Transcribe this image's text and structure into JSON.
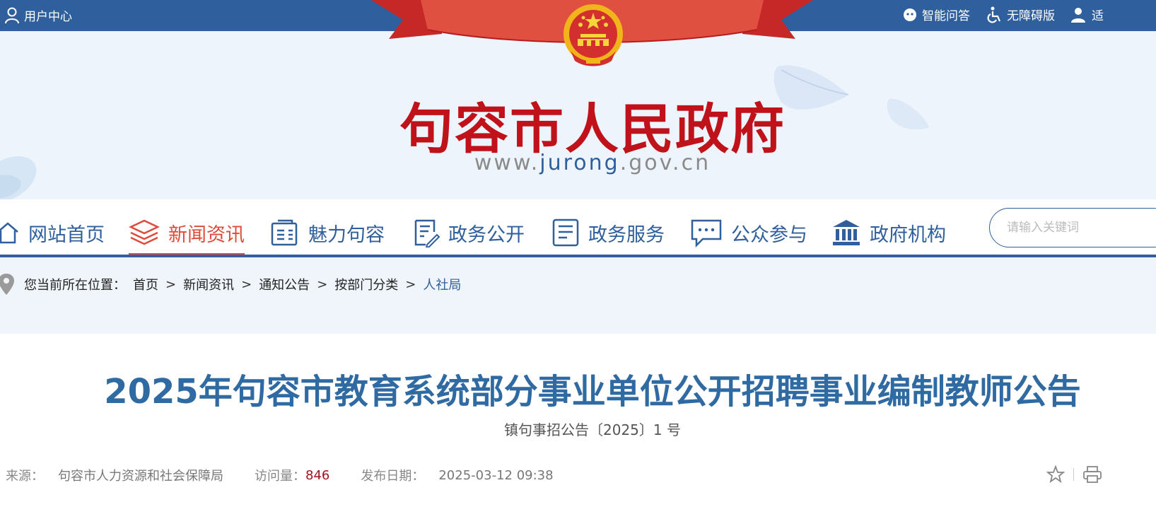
{
  "topbar": {
    "user_center": "用户中心",
    "smart_qa": "智能问答",
    "accessibility": "无障碍版",
    "elder_mode": "适"
  },
  "header": {
    "title": "句容市人民政府",
    "url_prefix": "www.",
    "url_highlight": "jurong",
    "url_suffix": ".gov.cn"
  },
  "nav": {
    "items": [
      {
        "label": "网站首页",
        "icon": "home-icon"
      },
      {
        "label": "新闻资讯",
        "icon": "layers-icon",
        "active": true
      },
      {
        "label": "魅力句容",
        "icon": "document-icon"
      },
      {
        "label": "政务公开",
        "icon": "edit-document-icon"
      },
      {
        "label": "政务服务",
        "icon": "list-icon"
      },
      {
        "label": "公众参与",
        "icon": "chat-icon"
      },
      {
        "label": "政府机构",
        "icon": "institution-icon"
      }
    ],
    "search_placeholder": "请输入关键词"
  },
  "breadcrumb": {
    "label": "您当前所在位置：",
    "items": [
      "首页",
      "新闻资讯",
      "通知公告",
      "按部门分类"
    ],
    "current": "人社局",
    "separator": ">"
  },
  "article": {
    "title": "2025年句容市教育系统部分事业单位公开招聘事业编制教师公告",
    "doc_number": "镇句事招公告〔2025〕1 号",
    "source_label": "来源：",
    "source": "句容市人力资源和社会保障局",
    "views_label": "访问量：",
    "views": "846",
    "date_label": "发布日期：",
    "date": "2025-03-12 09:38"
  },
  "colors": {
    "primary": "#2f5f9c",
    "active": "#e04a3b",
    "title_red": "#c0121b",
    "views": "#a0141e"
  }
}
